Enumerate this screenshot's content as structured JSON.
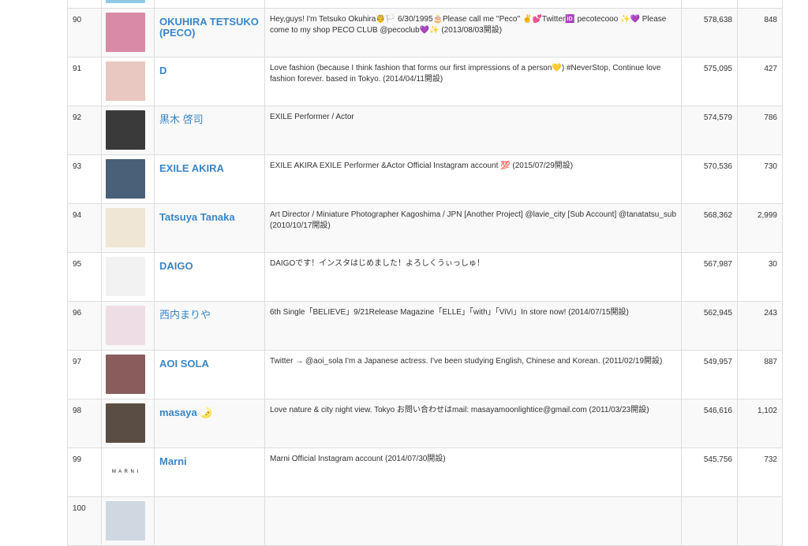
{
  "rows": [
    {
      "rank": "89",
      "name": "",
      "bio": "",
      "followers": "",
      "posts": "",
      "avatar_color": "#8fc9e6"
    },
    {
      "rank": "90",
      "name": "OKUHIRA TETSUKO (PECO)",
      "bio": "Hey,guys! I'm Tetsuko Okuhira🤴🏳️ 6/30/1995🎂Please call me ''Peco'' ✌️💕Twitter🆔 pecotecooo ✨💜 Please come to my shop PECO CLUB @pecoclub💜✨ (2013/08/03開設)",
      "followers": "578,638",
      "posts": "848",
      "avatar_color": "#d98aa6"
    },
    {
      "rank": "91",
      "name": "D",
      "bio": "Love fashion (because I think fashion that forms our first impressions of a person💛) #NeverStop, Continue love fashion forever. based in Tokyo. (2014/04/11開設)",
      "followers": "575,095",
      "posts": "427",
      "avatar_color": "#e8c8c0"
    },
    {
      "rank": "92",
      "name": "黒木 啓司",
      "bio": "EXILE Performer / Actor",
      "followers": "574,579",
      "posts": "786",
      "avatar_color": "#3a3a3a"
    },
    {
      "rank": "93",
      "name": "EXILE AKIRA",
      "bio": "EXILE AKIRA EXILE Performer &Actor Official Instagram account 💯 (2015/07/29開設)",
      "followers": "570,536",
      "posts": "730",
      "avatar_color": "#4a6078"
    },
    {
      "rank": "94",
      "name": "Tatsuya Tanaka",
      "bio": "Art Director / Miniature Photographer Kagoshima / JPN [Another Project] @lavie_city [Sub Account] @tanatatsu_sub (2010/10/17開設)",
      "followers": "568,362",
      "posts": "2,999",
      "avatar_color": "#efe6d6"
    },
    {
      "rank": "95",
      "name": "DAIGO",
      "bio": "DAIGOです！インスタはじめました！よろしくうぃっしゅ！",
      "followers": "567,987",
      "posts": "30",
      "avatar_color": "#f2f2f2"
    },
    {
      "rank": "96",
      "name": "西内まりや",
      "bio": "6th Single「BELIEVE」9/21Release Magazine「ELLE」「with」「ViVi」In store now! (2014/07/15開設)",
      "followers": "562,945",
      "posts": "243",
      "avatar_color": "#efdde6"
    },
    {
      "rank": "97",
      "name": "AOI SOLA",
      "bio": "Twitter → @aoi_sola I'm a Japanese actress. I've been studying English, Chinese and Korean. (2011/02/19開設)",
      "followers": "549,957",
      "posts": "887",
      "avatar_color": "#8a5c5c"
    },
    {
      "rank": "98",
      "name": "masaya 🌛",
      "bio": "Love nature & city night view. Tokyo お問い合わせはmail: masayamoonlightice@gmail.com (2011/03/23開設)",
      "followers": "546,616",
      "posts": "1,102",
      "avatar_color": "#5a4e44"
    },
    {
      "rank": "99",
      "name": "Marni",
      "bio": "Marni Official Instagram account (2014/07/30開設)",
      "followers": "545,756",
      "posts": "732",
      "avatar_color": "#ffffff",
      "avatar_text": "M A R N I"
    },
    {
      "rank": "100",
      "name": "",
      "bio": "",
      "followers": "",
      "posts": "",
      "avatar_color": "#cfd8e0"
    }
  ]
}
